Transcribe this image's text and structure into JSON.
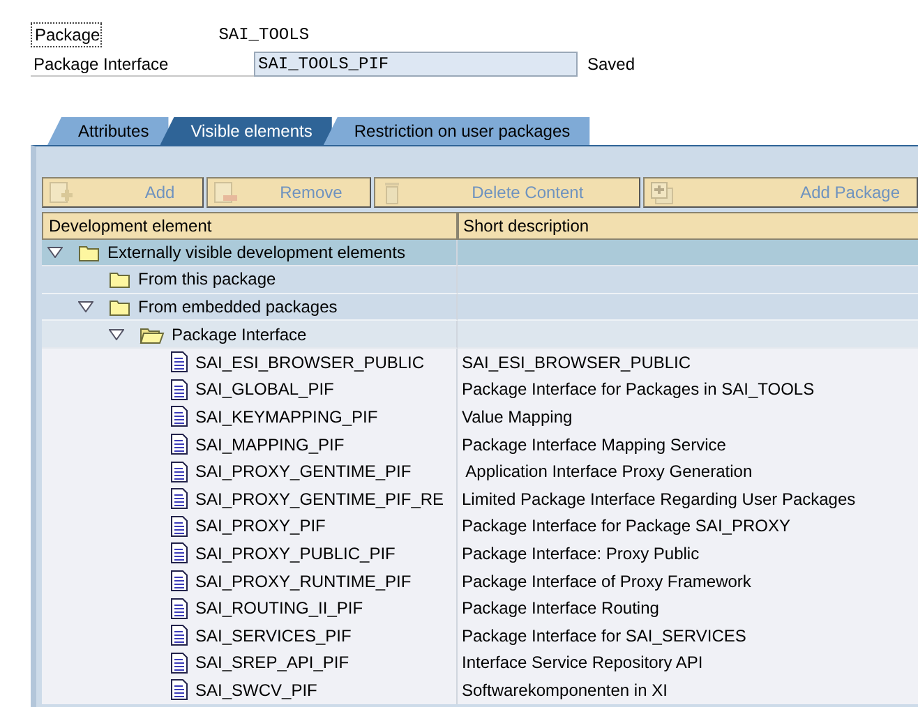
{
  "header": {
    "fields": [
      {
        "label": "Package",
        "value": "SAI_TOOLS",
        "kind": "display",
        "focused": true
      },
      {
        "label": "Package Interface",
        "value": "SAI_TOOLS_PIF",
        "kind": "input",
        "focused": false,
        "status": "Saved"
      }
    ]
  },
  "tabs": [
    {
      "label": "Attributes",
      "selected": false
    },
    {
      "label": "Visible elements",
      "selected": true
    },
    {
      "label": "Restriction on user packages",
      "selected": false
    }
  ],
  "toolbar": [
    {
      "label": "Add",
      "kind": "add",
      "disabled": true
    },
    {
      "label": "Remove",
      "kind": "remove",
      "disabled": true
    },
    {
      "label": "Delete Content",
      "kind": "delete",
      "disabled": true
    },
    {
      "label": "Add Package",
      "kind": "package",
      "disabled": true
    }
  ],
  "table": {
    "columns": [
      "Development element",
      "Short description"
    ],
    "rows": [
      {
        "name": "Externally visible development elements",
        "kind": "folder",
        "expanded": true,
        "selected": true,
        "children": [
          {
            "name": "From this package",
            "kind": "folder",
            "selected": false
          },
          {
            "name": "From embedded packages",
            "kind": "folder",
            "expanded": true,
            "selected": false,
            "children": [
              {
                "name": "Package Interface",
                "kind": "open-folder",
                "expanded": true,
                "selected": false,
                "children": [
                  {
                    "name": "SAI_ESI_BROWSER_PUBLIC",
                    "description": "SAI_ESI_BROWSER_PUBLIC",
                    "kind": "document",
                    "selected": false
                  },
                  {
                    "name": "SAI_GLOBAL_PIF",
                    "description": "Package Interface for Packages in SAI_TOOLS",
                    "kind": "document",
                    "selected": false
                  },
                  {
                    "name": "SAI_KEYMAPPING_PIF",
                    "description": "Value Mapping",
                    "kind": "document",
                    "selected": false
                  },
                  {
                    "name": "SAI_MAPPING_PIF",
                    "description": "Package Interface Mapping Service",
                    "kind": "document",
                    "selected": false
                  },
                  {
                    "name": "SAI_PROXY_GENTIME_PIF",
                    "description": " Application Interface Proxy Generation",
                    "kind": "document",
                    "selected": false
                  },
                  {
                    "name": "SAI_PROXY_GENTIME_PIF_RE",
                    "description": "Limited Package Interface Regarding User Packages",
                    "kind": "document",
                    "selected": false
                  },
                  {
                    "name": "SAI_PROXY_PIF",
                    "description": "Package Interface for Package SAI_PROXY",
                    "kind": "document",
                    "selected": false
                  },
                  {
                    "name": "SAI_PROXY_PUBLIC_PIF",
                    "description": "Package Interface: Proxy Public",
                    "kind": "document",
                    "selected": false
                  },
                  {
                    "name": "SAI_PROXY_RUNTIME_PIF",
                    "description": "Package Interface of Proxy Framework",
                    "kind": "document",
                    "selected": false
                  },
                  {
                    "name": "SAI_ROUTING_II_PIF",
                    "description": "Package Interface Routing",
                    "kind": "document",
                    "selected": false
                  },
                  {
                    "name": "SAI_SERVICES_PIF",
                    "description": "Package Interface for SAI_SERVICES",
                    "kind": "document",
                    "selected": false
                  },
                  {
                    "name": "SAI_SREP_API_PIF",
                    "description": "Interface Service Repository API",
                    "kind": "document",
                    "selected": false
                  },
                  {
                    "name": "SAI_SWCV_PIF",
                    "description": "Softwarekomponenten in XI",
                    "kind": "document",
                    "selected": false
                  }
                ]
              }
            ]
          }
        ]
      }
    ]
  }
}
